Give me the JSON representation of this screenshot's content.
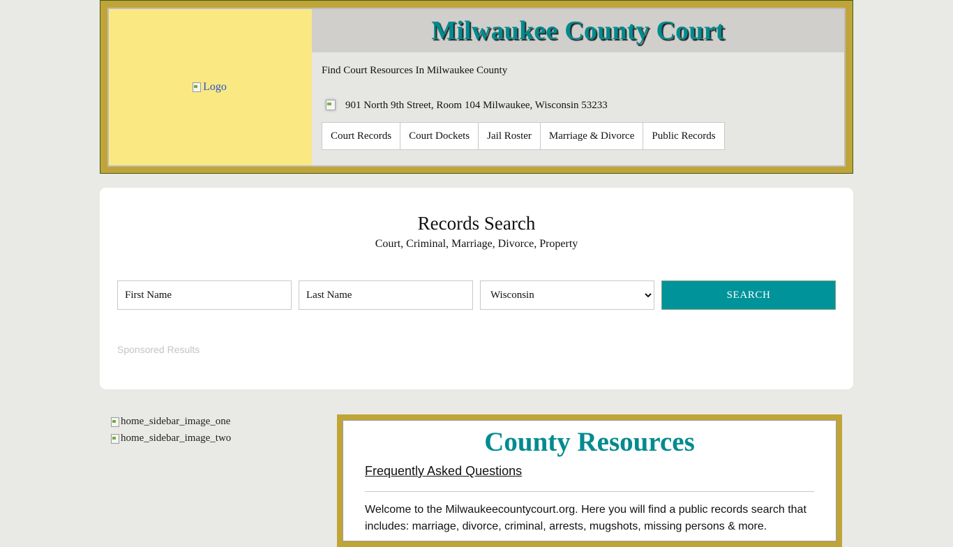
{
  "header": {
    "logo_alt": "Logo",
    "title": "Milwaukee County Court",
    "tagline": "Find Court Resources In Milwaukee County",
    "address": "901 North 9th Street, Room 104 Milwaukee, Wisconsin 53233",
    "nav": [
      {
        "label": "Court Records"
      },
      {
        "label": "Court Dockets"
      },
      {
        "label": "Jail Roster"
      },
      {
        "label": "Marriage & Divorce"
      },
      {
        "label": "Public Records"
      }
    ]
  },
  "search": {
    "title": "Records Search",
    "subtitle": "Court, Criminal, Marriage, Divorce, Property",
    "first_name_placeholder": "First Name",
    "last_name_placeholder": "Last Name",
    "state_selected": "Wisconsin",
    "button_label": "SEARCH",
    "sponsored": "Sponsored Results"
  },
  "sidebar": {
    "image_one_alt": "home_sidebar_image_one",
    "image_two_alt": "home_sidebar_image_two"
  },
  "resources": {
    "title": "County Resources",
    "faq_link": "Frequently Asked Questions",
    "intro": "Welcome to the Milwaukeecountycourt.org. Here you will find a public records search that includes: marriage, divorce, criminal, arrests, mugshots, missing persons & more."
  },
  "colors": {
    "accent_teal": "#008b8e",
    "frame_gold": "#c0a437",
    "logo_panel": "#fae883",
    "button": "#00939a"
  }
}
